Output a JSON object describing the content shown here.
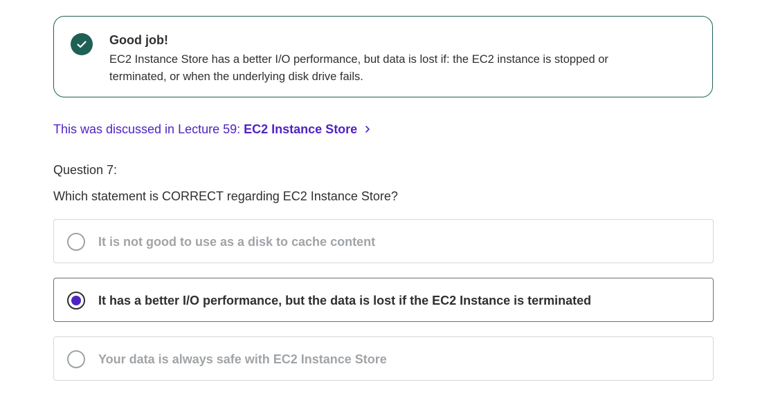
{
  "feedback": {
    "title": "Good job!",
    "body": "EC2 Instance Store has a better I/O performance, but data is lost if: the EC2 instance is stopped or terminated, or when the underlying disk drive fails.",
    "icon": "check-circle-icon",
    "accent_color": "#1e6055"
  },
  "lecture_link": {
    "prefix": "This was discussed in Lecture 59:",
    "name": "EC2 Instance Store",
    "icon": "chevron-right-icon",
    "color": "#5022c3"
  },
  "question": {
    "number_label": "Question 7:",
    "text": "Which statement is CORRECT regarding EC2 Instance Store?",
    "options": [
      {
        "label": "It is not good to use as a disk to cache content",
        "selected": false
      },
      {
        "label": "It has a better I/O performance, but the data is lost if the EC2 Instance is terminated",
        "selected": true
      },
      {
        "label": "Your data is always safe with EC2 Instance Store",
        "selected": false
      }
    ],
    "selected_color": "#5022c3"
  }
}
